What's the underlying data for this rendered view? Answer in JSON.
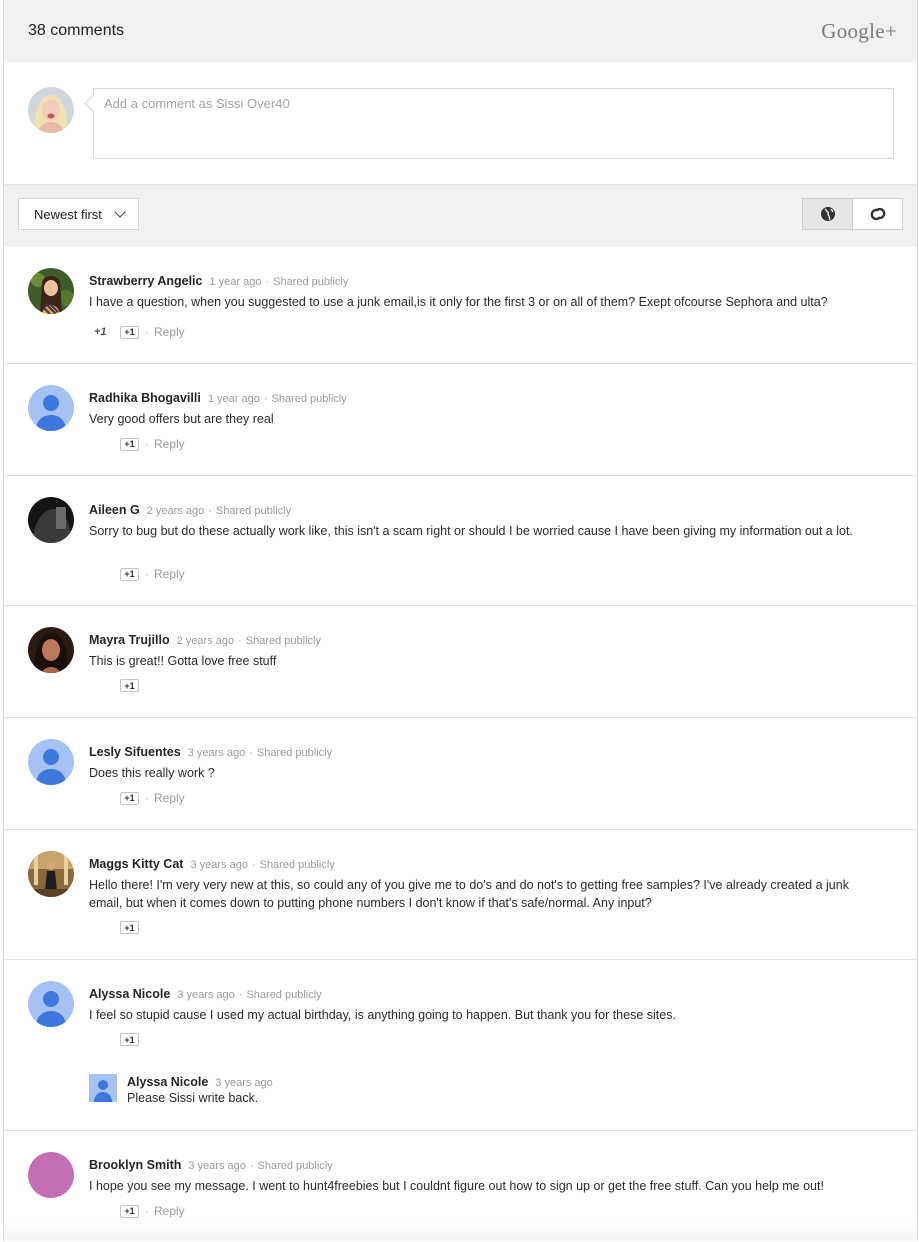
{
  "header": {
    "count": "38 comments",
    "brand": "Google+"
  },
  "composer": {
    "placeholder": "Add a comment as Sissi Over40"
  },
  "toolbar": {
    "sort_label": "Newest first"
  },
  "actions": {
    "plus_one": "+1",
    "reply": "Reply",
    "separator": "·"
  },
  "comments": [
    {
      "name": "Strawberry Angelic",
      "time": "1 year ago",
      "visibility": "Shared publicly",
      "text": "I have a question, when you suggested to use a junk email,is it only for the first 3 or on all of them? Exept ofcourse Sephora and ulta?",
      "plus_count": "+1"
    },
    {
      "name": "Radhika Bhogavilli",
      "time": "1 year ago",
      "visibility": "Shared publicly",
      "text": "Very good offers but are they real"
    },
    {
      "name": "Aileen G",
      "time": "2 years ago",
      "visibility": "Shared publicly",
      "text": "Sorry to bug but do these actually work like, this isn't a scam right or should I be worried cause I have been giving my information out a lot."
    },
    {
      "name": "Mayra Trujillo",
      "time": "2 years ago",
      "visibility": "Shared publicly",
      "text": "This is great!! Gotta love free stuff"
    },
    {
      "name": "Lesly Sifuentes",
      "time": "3 years ago",
      "visibility": "Shared publicly",
      "text": "Does this really work ?"
    },
    {
      "name": "Maggs Kitty Cat",
      "time": "3 years ago",
      "visibility": "Shared publicly",
      "text": "Hello there! I'm very very new at this, so could any of you give me to do's and do not's to getting free samples? I've already created a junk email, but when it comes down to putting phone numbers I don't know if that's safe/normal. Any input?"
    },
    {
      "name": "Alyssa Nicole",
      "time": "3 years ago",
      "visibility": "Shared publicly",
      "text": "I feel so stupid cause I used my actual birthday, is anything going to happen. But thank you for these sites.",
      "reply": {
        "name": "Alyssa Nicole",
        "time": "3 years ago",
        "text": "Please Sissi write back."
      }
    },
    {
      "name": "Brooklyn Smith",
      "time": "3 years ago",
      "visibility": "Shared publicly",
      "text": "I hope you see my message. I went to hunt4freebies but I couldnt figure out how to sign up or get the free stuff. Can you help me out!"
    }
  ]
}
